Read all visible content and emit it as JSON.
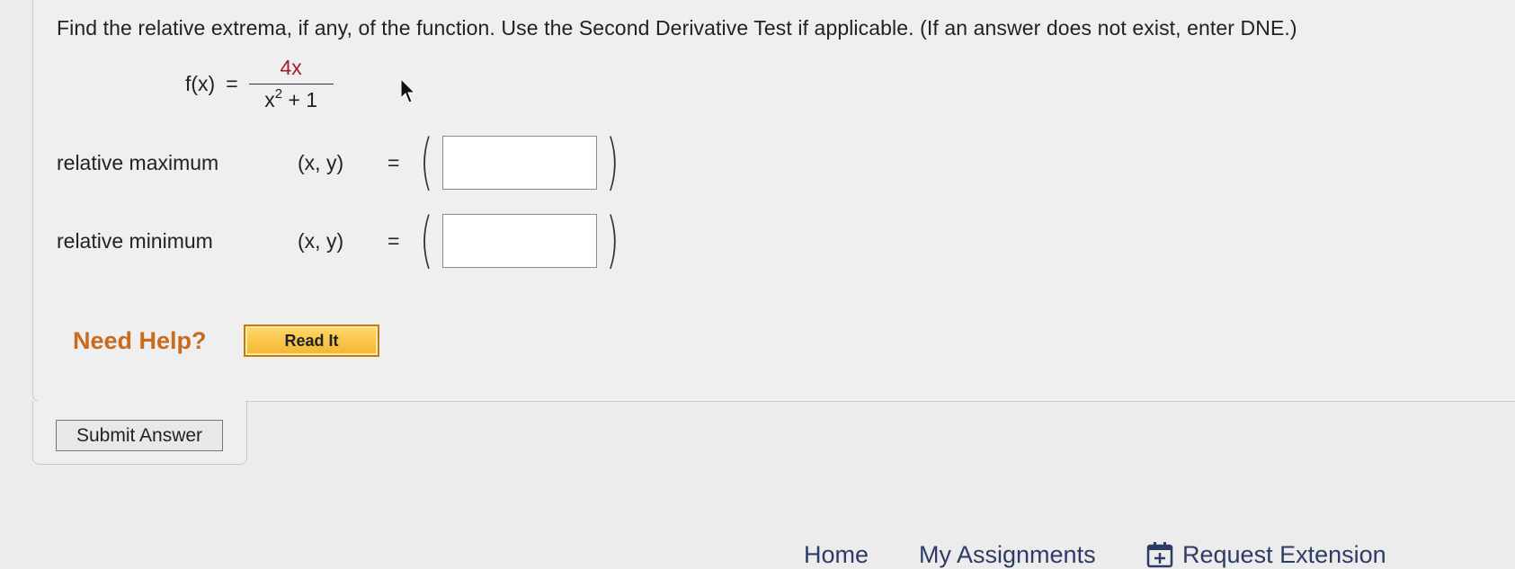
{
  "question": {
    "text": "Find the relative extrema, if any, of the function. Use the Second Derivative Test if applicable. (If an answer does not exist, enter DNE.)"
  },
  "function": {
    "name": "f(x)",
    "equals": "=",
    "numerator": "4x",
    "denominator_base": "x",
    "denominator_exp": "2",
    "denominator_rest": "+ 1"
  },
  "rows": [
    {
      "label": "relative maximum",
      "var": "(x, y)",
      "equals": "=",
      "open": "(",
      "close": ")",
      "value": ""
    },
    {
      "label": "relative minimum",
      "var": "(x, y)",
      "equals": "=",
      "open": "(",
      "close": ")",
      "value": ""
    }
  ],
  "help": {
    "text": "Need Help?",
    "read_it_label": "Read It"
  },
  "submit": {
    "label": "Submit Answer"
  },
  "nav": {
    "home": "Home",
    "assignments": "My Assignments",
    "extension": "Request Extension"
  },
  "icons": {
    "cursor": "mouse-pointer-icon",
    "extension": "calendar-plus-icon"
  },
  "colors": {
    "numerator": "#a8192a",
    "help": "#c96a1c",
    "nav": "#2d3c66",
    "read_it": "#f3b52f"
  }
}
